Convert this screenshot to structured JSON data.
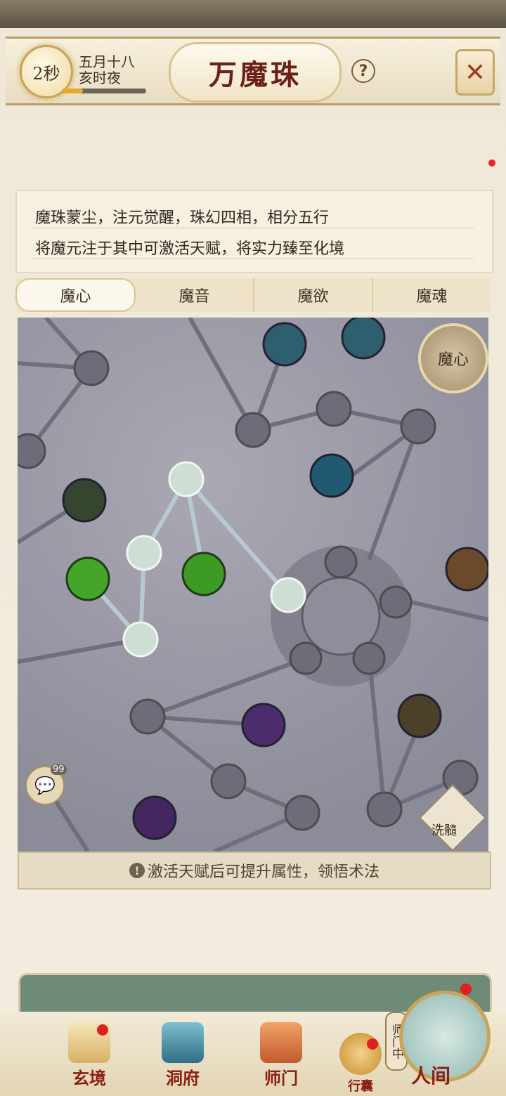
{
  "header": {
    "timer": "2秒",
    "date_line1": "五月十八",
    "date_line2": "亥时夜",
    "progress": 0.25,
    "title": "万魔珠",
    "help": "?",
    "close_icon": "close-icon"
  },
  "description": {
    "line1": "魔珠蒙尘，注元觉醒，珠幻四相，相分五行",
    "line2": "将魔元注于其中可激活天赋，将实力臻至化境"
  },
  "tabs": [
    {
      "label": "魔心",
      "active": true
    },
    {
      "label": "魔音",
      "active": false
    },
    {
      "label": "魔欲",
      "active": false
    },
    {
      "label": "魔魂",
      "active": false
    }
  ],
  "map": {
    "core_label": "魔心",
    "chat_count": "99",
    "wash_label": "洗髓",
    "hint": "激活天赋后可提升属性，领悟术法"
  },
  "nav": [
    {
      "label": "玄境",
      "icon": "scroll-icon"
    },
    {
      "label": "洞府",
      "icon": "pavilion-icon"
    },
    {
      "label": "师门",
      "icon": "banner-icon"
    },
    {
      "label": "行囊",
      "icon": "bag-icon"
    }
  ],
  "human": {
    "label": "人间",
    "sect": "师门中"
  },
  "colors": {
    "accent": "#8b1f12",
    "gold": "#caa25a",
    "map_bg": "#8c8b98"
  }
}
